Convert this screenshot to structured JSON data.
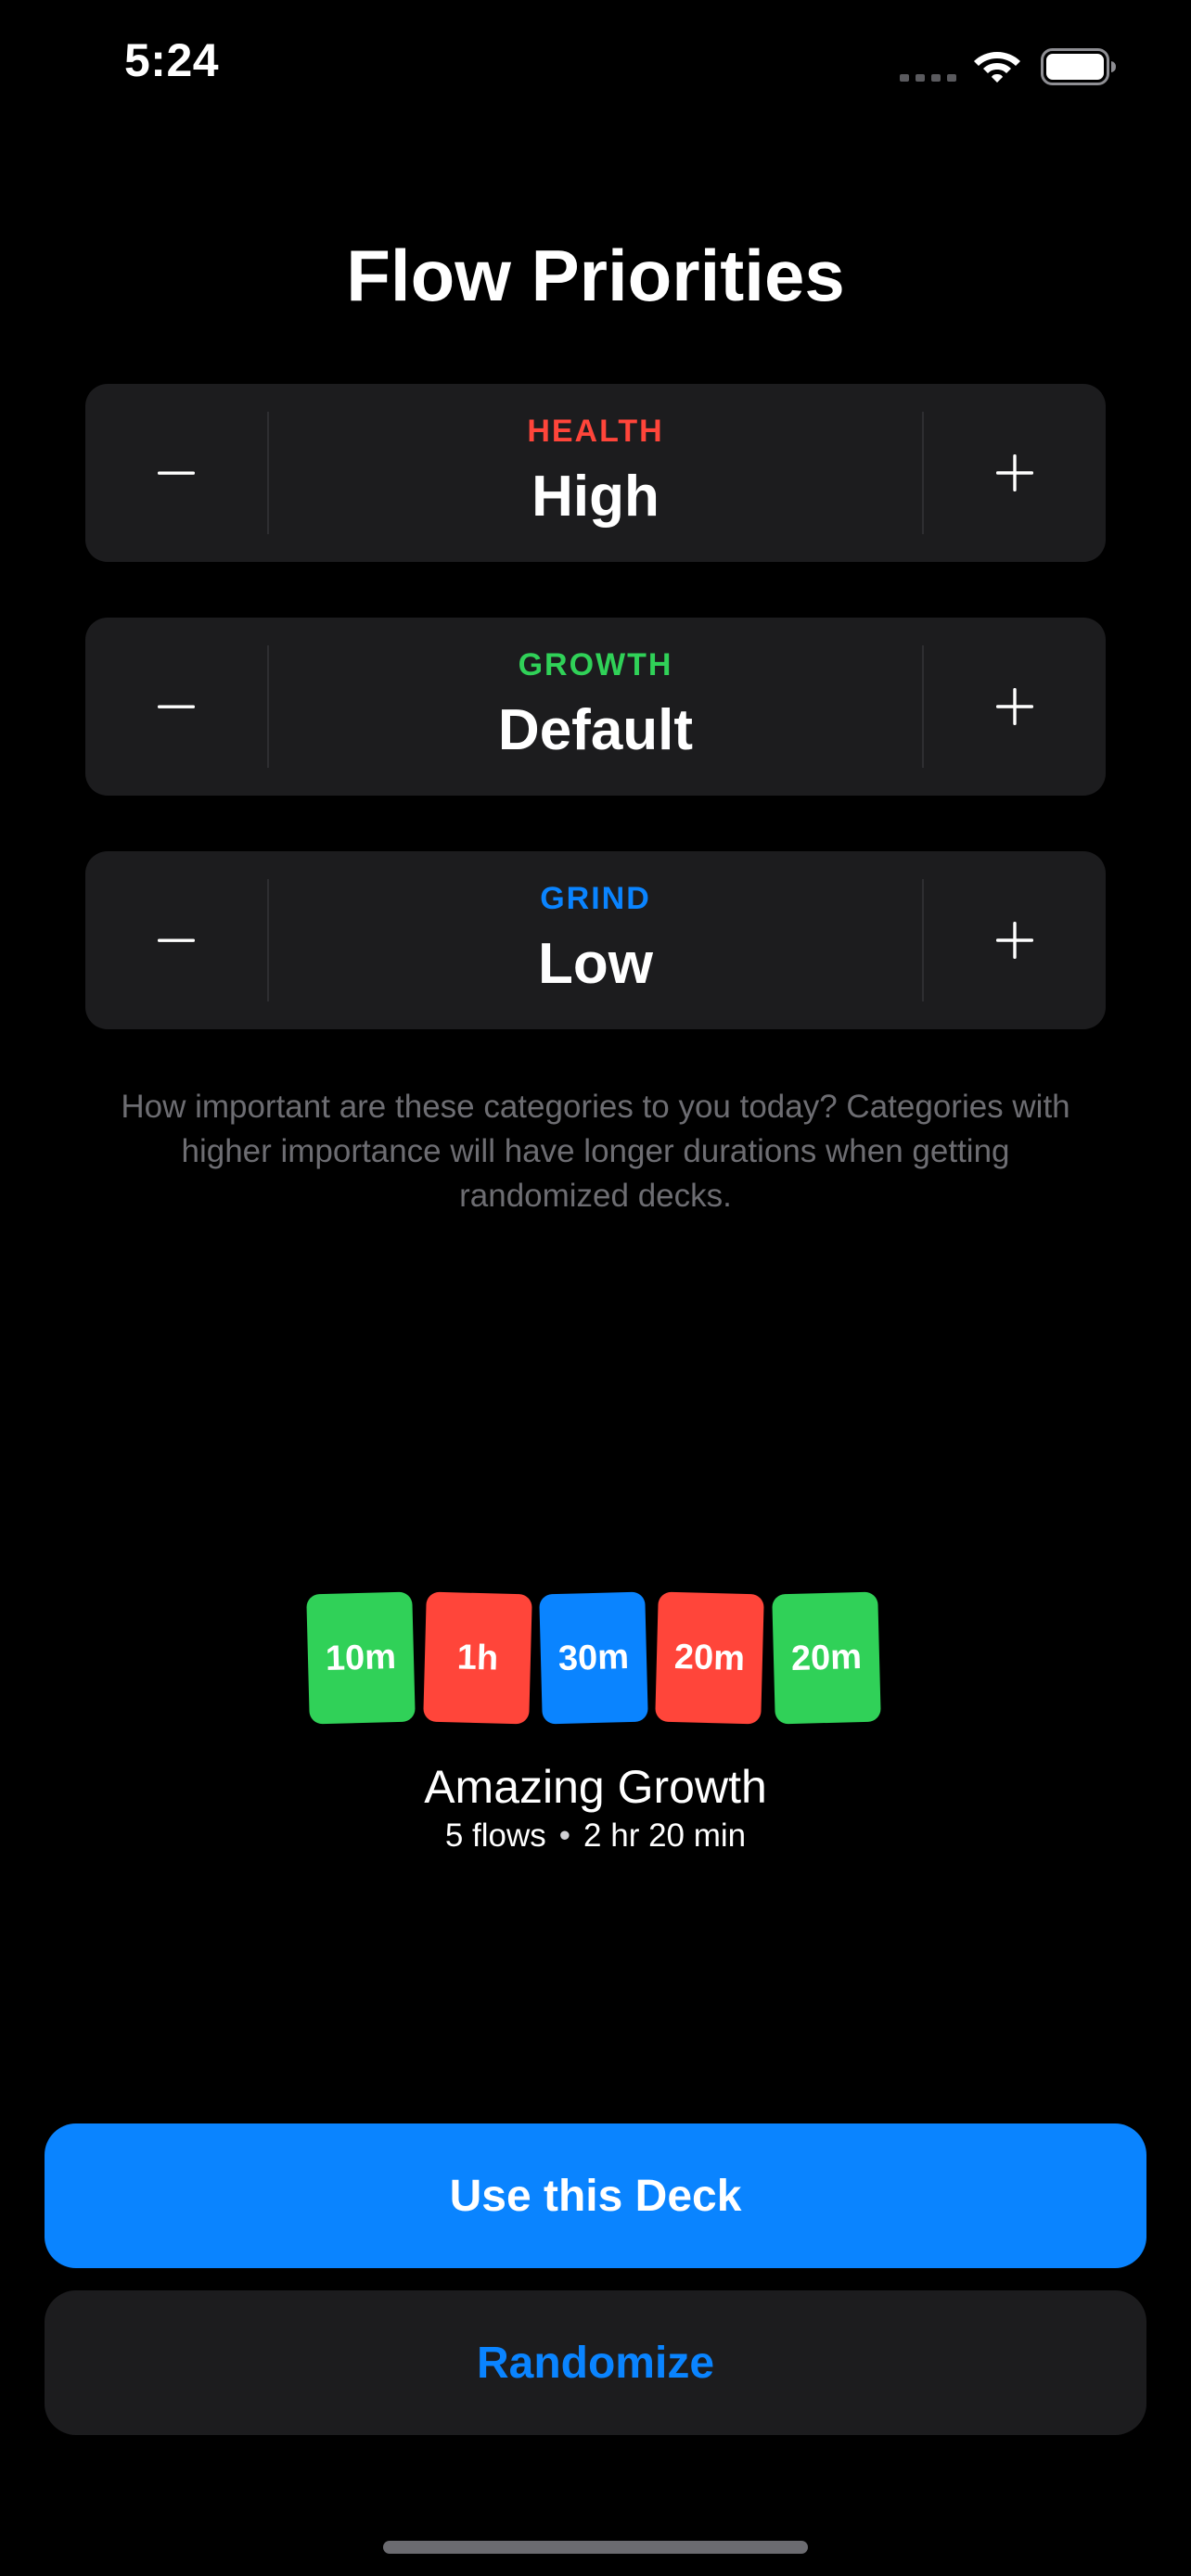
{
  "status_bar": {
    "time": "5:24",
    "icons": [
      "signal-icon",
      "wifi-icon",
      "battery-icon"
    ]
  },
  "title": "Flow Priorities",
  "priorities": [
    {
      "category": "HEALTH",
      "value": "High",
      "color": "#ff453a"
    },
    {
      "category": "GROWTH",
      "value": "Default",
      "color": "#30d158"
    },
    {
      "category": "GRIND",
      "value": "Low",
      "color": "#0a84ff"
    }
  ],
  "help_text": "How important are these categories to you today? Categories with higher importance will have longer durations when getting randomized decks.",
  "deck": {
    "cards": [
      {
        "label": "10m",
        "color": "#30d158"
      },
      {
        "label": "1h",
        "color": "#ff453a"
      },
      {
        "label": "30m",
        "color": "#0a84ff"
      },
      {
        "label": "20m",
        "color": "#ff453a"
      },
      {
        "label": "20m",
        "color": "#30d158"
      }
    ],
    "name": "Amazing Growth",
    "flow_count": "5 flows",
    "separator": "•",
    "duration": "2 hr 20 min"
  },
  "buttons": {
    "use_deck": "Use this Deck",
    "randomize": "Randomize"
  },
  "colors": {
    "accent": "#0a84ff",
    "card_background": "#1c1c1e",
    "background": "#000000"
  }
}
